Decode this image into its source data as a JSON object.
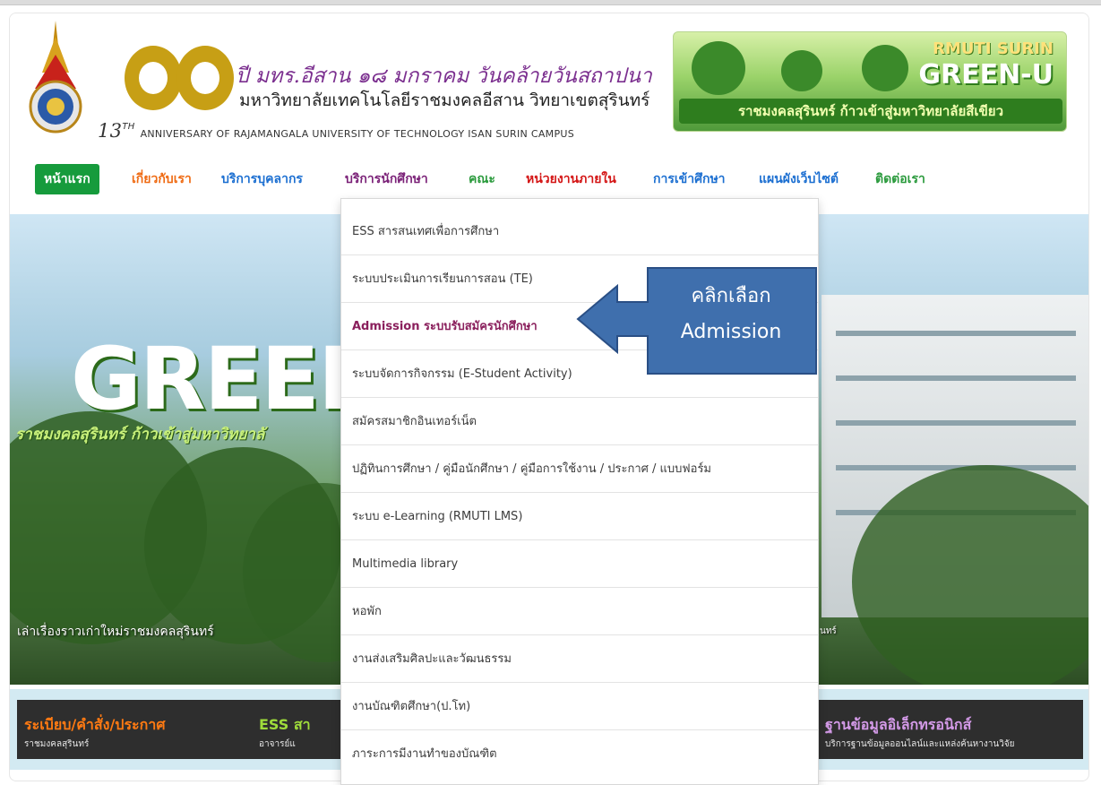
{
  "header": {
    "title_years": "๑๓",
    "title_line1": "ปี มทร.อีสาน ๑๘ มกราคม วันคล้ายวันสถาปนา",
    "title_line2": "มหาวิทยาลัยเทคโนโลยีราชมงคลอีสาน วิทยาเขตสุรินทร์",
    "title_line3_num": "13",
    "title_line3_sup": "TH",
    "title_line3": "ANNIVERSARY OF RAJAMANGALA UNIVERSITY OF TECHNOLOGY ISAN SURIN CAMPUS",
    "banner_line1": "RMUTI SURIN",
    "banner_line2": "GREEN-U",
    "banner_line3": "ราชมงคลสุรินทร์ ก้าวเข้าสู่มหาวิทยาลัยสีเขียว"
  },
  "nav": {
    "items": [
      {
        "label": "หน้าแรก"
      },
      {
        "label": "เกี่ยวกับเรา"
      },
      {
        "label": "บริการบุคลากร"
      },
      {
        "label": "บริการนักศึกษา"
      },
      {
        "label": "คณะ"
      },
      {
        "label": "หน่วยงานภายใน"
      },
      {
        "label": "การเข้าศึกษา"
      },
      {
        "label": "แผนผังเว็บไซต์"
      },
      {
        "label": "ติดต่อเรา"
      }
    ]
  },
  "dropdown": {
    "items": [
      {
        "label": "ESS สารสนเทศเพื่อการศึกษา"
      },
      {
        "label": "ระบบประเมินการเรียนการสอน (TE)"
      },
      {
        "label": "Admission ระบบรับสมัครนักศึกษา"
      },
      {
        "label": "ระบบจัดการกิจกรรม (E-Student Activity)"
      },
      {
        "label": "สมัครสมาชิกอินเทอร์เน็ต"
      },
      {
        "label": "ปฏิทินการศึกษา / คู่มือนักศึกษา / คู่มือการใช้งาน / ประกาศ / แบบฟอร์ม"
      },
      {
        "label": "ระบบ e-Learning (RMUTI LMS)"
      },
      {
        "label": "Multimedia library"
      },
      {
        "label": "หอพัก"
      },
      {
        "label": "งานส่งเสริมศิลปะและวัฒนธรรม"
      },
      {
        "label": "งานบัณฑิตศึกษา(ป.โท)"
      },
      {
        "label": "ภาระการมีงานทำของบัณฑิต"
      }
    ]
  },
  "callout": {
    "line1": "คลิกเลือก",
    "line2": "Admission"
  },
  "hero": {
    "logo_text": "GREEN",
    "logo_sub": "ราชมงคลสุรินทร์ ก้าวเข้าสู่มหาวิทยาลั",
    "caption": "เล่าเรื่องราวเก่าใหม่ราชมงคลสุรินทร์",
    "caption_right": "นทร์"
  },
  "strip": {
    "left_title": "ระเบียบ/คำสั่ง/ประกาศ",
    "left_sub": "ราชมงคลสุรินทร์",
    "mid_title": "ESS สา",
    "mid_sub": "อาจารย์แ",
    "right_title": "ฐานข้อมูลอิเล็กทรอนิกส์",
    "right_sub": "บริการฐานข้อมูลออนไลน์และแหล่งค้นหางานวิจัย"
  },
  "colors": {
    "nav_home_bg": "#169b3c",
    "nav_orange": "#ef6a12",
    "nav_blue": "#1c6fd1",
    "nav_purple": "#7b2278",
    "nav_red": "#d41616",
    "callout_fill": "#3f6fad",
    "active_item": "#8a1f5c"
  },
  "icons": {
    "emblem": "university-emblem-icon",
    "arrow": "left-arrow-icon"
  }
}
